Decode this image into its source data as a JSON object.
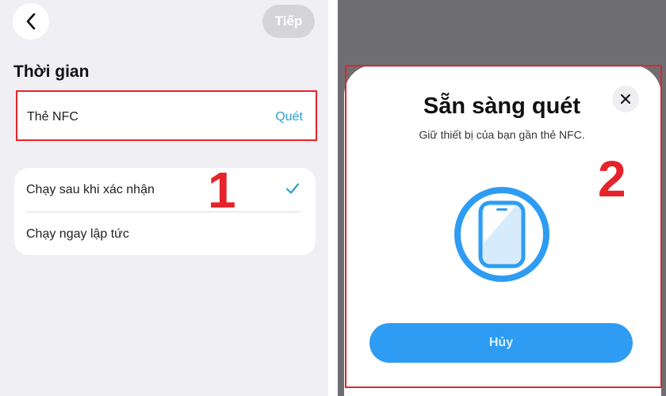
{
  "header": {
    "next_label": "Tiếp"
  },
  "section": {
    "title": "Thời gian"
  },
  "nfc": {
    "label": "Thẻ NFC",
    "action": "Quét"
  },
  "options": [
    {
      "label": "Chạy sau khi xác nhận",
      "selected": true
    },
    {
      "label": "Chạy ngay lập tức",
      "selected": false
    }
  ],
  "step_markers": {
    "first": "1",
    "second": "2"
  },
  "dialog": {
    "title": "Sẵn sàng quét",
    "subtitle": "Giữ thiết bị của bạn gần thẻ NFC.",
    "cancel_label": "Hủy"
  },
  "colors": {
    "accent": "#2ea1cf",
    "primary_button": "#2e9cf2",
    "highlight_outline": "#e5232b",
    "ring": "#2e9cf2"
  },
  "icons": {
    "back": "chevron-left-icon",
    "check": "checkmark-icon",
    "close": "close-icon",
    "scan_illustration": "phone-nfc-icon"
  }
}
